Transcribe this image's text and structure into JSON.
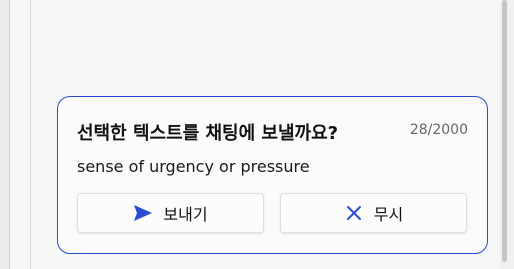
{
  "dialog": {
    "title": "선택한 텍스트를 채팅에 보낼까요?",
    "char_count": "28/2000",
    "selected_text": "sense of urgency or pressure",
    "send_button": {
      "label": "보내기",
      "icon": "send-icon"
    },
    "ignore_button": {
      "label": "무시",
      "icon": "close-icon"
    }
  },
  "colors": {
    "accent": "#2a4bd1",
    "card_background": "#fbfbfb",
    "page_background": "#f6f6f6"
  }
}
